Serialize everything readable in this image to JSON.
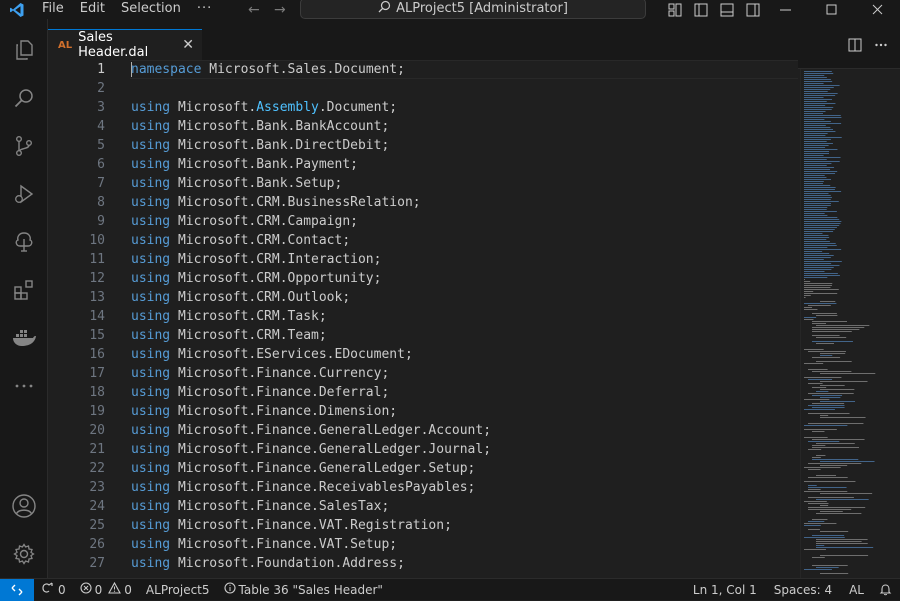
{
  "titlebar": {
    "menu": [
      "File",
      "Edit",
      "Selection"
    ],
    "more": "···",
    "command_center": "ALProject5 [Administrator]"
  },
  "tab": {
    "lang": "AL",
    "label": "Sales Header.dal",
    "close": "✕"
  },
  "editor": {
    "lines": [
      {
        "n": "1",
        "kw": "namespace",
        "text": " Microsoft.Sales.Document;"
      },
      {
        "n": "2",
        "kw": "",
        "text": ""
      },
      {
        "n": "3",
        "kw": "using",
        "text": " Microsoft.",
        "hl": "Assembly",
        "rest": ".Document;"
      },
      {
        "n": "4",
        "kw": "using",
        "text": " Microsoft.Bank.BankAccount;"
      },
      {
        "n": "5",
        "kw": "using",
        "text": " Microsoft.Bank.DirectDebit;"
      },
      {
        "n": "6",
        "kw": "using",
        "text": " Microsoft.Bank.Payment;"
      },
      {
        "n": "7",
        "kw": "using",
        "text": " Microsoft.Bank.Setup;"
      },
      {
        "n": "8",
        "kw": "using",
        "text": " Microsoft.CRM.BusinessRelation;"
      },
      {
        "n": "9",
        "kw": "using",
        "text": " Microsoft.CRM.Campaign;"
      },
      {
        "n": "10",
        "kw": "using",
        "text": " Microsoft.CRM.Contact;"
      },
      {
        "n": "11",
        "kw": "using",
        "text": " Microsoft.CRM.Interaction;"
      },
      {
        "n": "12",
        "kw": "using",
        "text": " Microsoft.CRM.Opportunity;"
      },
      {
        "n": "13",
        "kw": "using",
        "text": " Microsoft.CRM.Outlook;"
      },
      {
        "n": "14",
        "kw": "using",
        "text": " Microsoft.CRM.Task;"
      },
      {
        "n": "15",
        "kw": "using",
        "text": " Microsoft.CRM.Team;"
      },
      {
        "n": "16",
        "kw": "using",
        "text": " Microsoft.EServices.EDocument;"
      },
      {
        "n": "17",
        "kw": "using",
        "text": " Microsoft.Finance.Currency;"
      },
      {
        "n": "18",
        "kw": "using",
        "text": " Microsoft.Finance.Deferral;"
      },
      {
        "n": "19",
        "kw": "using",
        "text": " Microsoft.Finance.Dimension;"
      },
      {
        "n": "20",
        "kw": "using",
        "text": " Microsoft.Finance.GeneralLedger.Account;"
      },
      {
        "n": "21",
        "kw": "using",
        "text": " Microsoft.Finance.GeneralLedger.Journal;"
      },
      {
        "n": "22",
        "kw": "using",
        "text": " Microsoft.Finance.GeneralLedger.Setup;"
      },
      {
        "n": "23",
        "kw": "using",
        "text": " Microsoft.Finance.ReceivablesPayables;"
      },
      {
        "n": "24",
        "kw": "using",
        "text": " Microsoft.Finance.SalesTax;"
      },
      {
        "n": "25",
        "kw": "using",
        "text": " Microsoft.Finance.VAT.Registration;"
      },
      {
        "n": "26",
        "kw": "using",
        "text": " Microsoft.Finance.VAT.Setup;"
      },
      {
        "n": "27",
        "kw": "using",
        "text": " Microsoft.Foundation.Address;"
      }
    ]
  },
  "statusbar": {
    "ports": "0",
    "errors": "0",
    "warnings": "0",
    "project": "ALProject5",
    "object": "Table 36 \"Sales Header\"",
    "position": "Ln 1, Col 1",
    "spaces": "Spaces: 4",
    "language": "AL"
  },
  "colors": {
    "accent": "#0078d4",
    "keyword": "#569cd6",
    "namespace_highlight": "#4fc1ff",
    "al_badge": "#cf6f2c"
  },
  "icons": {
    "activity": [
      "explorer-icon",
      "search-icon",
      "source-control-icon",
      "run-debug-icon",
      "tree-icon",
      "extensions-icon",
      "docker-icon",
      "more-icon",
      "account-icon",
      "settings-gear-icon"
    ]
  }
}
